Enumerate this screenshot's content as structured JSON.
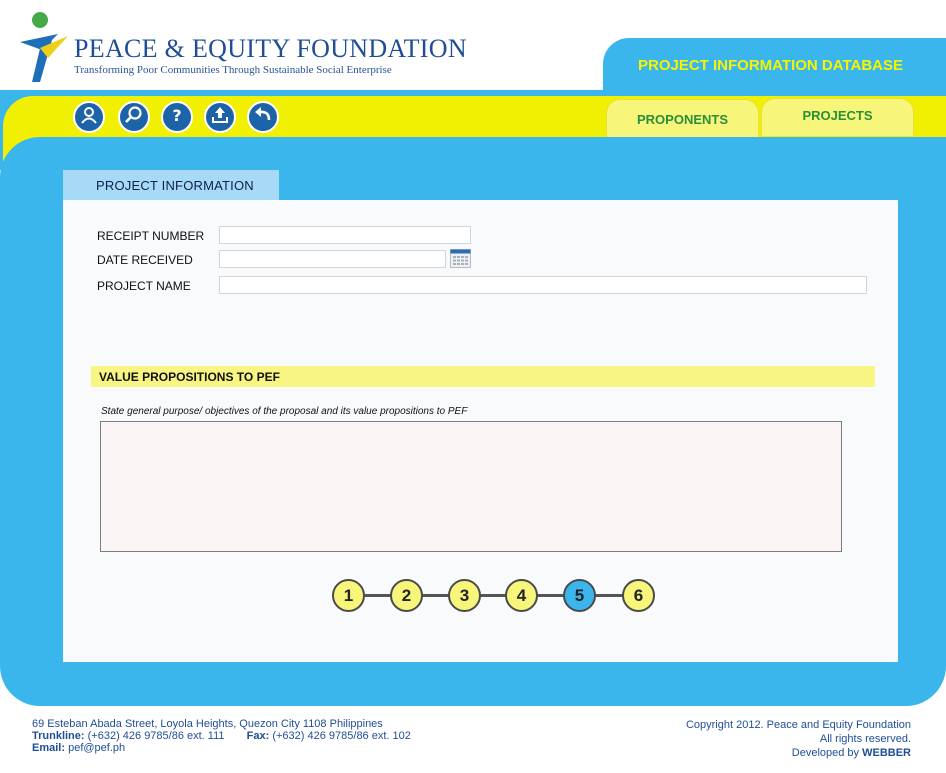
{
  "header": {
    "org_name": "PEACE & EQUITY FOUNDATION",
    "tagline": "Transforming Poor Communities Through Sustainable Social Enterprise",
    "database_title": "PROJECT INFORMATION DATABASE",
    "accent_blue": "#3bb6ec",
    "accent_yellow": "#f2f002"
  },
  "toolbar": {
    "icons": [
      "user-icon",
      "search-icon",
      "help-icon",
      "upload-icon",
      "back-icon"
    ]
  },
  "nav": {
    "tabs": [
      {
        "label": "PROPONENTS"
      },
      {
        "label": "PROJECTS"
      }
    ]
  },
  "form": {
    "section_title": "PROJECT INFORMATION",
    "receipt_number": {
      "label": "RECEIPT NUMBER",
      "value": ""
    },
    "date_received": {
      "label": "DATE RECEIVED",
      "value": ""
    },
    "project_name": {
      "label": "PROJECT NAME",
      "value": ""
    },
    "value_propositions": {
      "title": "VALUE PROPOSITIONS TO PEF",
      "hint": "State general purpose/ objectives of the proposal and its value propositions to PEF",
      "value": ""
    }
  },
  "steps": {
    "items": [
      "1",
      "2",
      "3",
      "4",
      "5",
      "6"
    ],
    "active": "5"
  },
  "footer": {
    "address": "69 Esteban Abada Street, Loyola Heights, Quezon City 1108 Philippines",
    "trunkline_label": "Trunkline:",
    "trunkline_value": "(+632) 426 9785/86 ext. 111",
    "fax_label": "Fax:",
    "fax_value": "(+632) 426 9785/86 ext. 102",
    "email_label": "Email:",
    "email_value": "pef@pef.ph",
    "copyright": "Copyright 2012. Peace and Equity Foundation",
    "rights": "All rights reserved.",
    "developed_by": "Developed by",
    "developer": "WEBBER"
  }
}
